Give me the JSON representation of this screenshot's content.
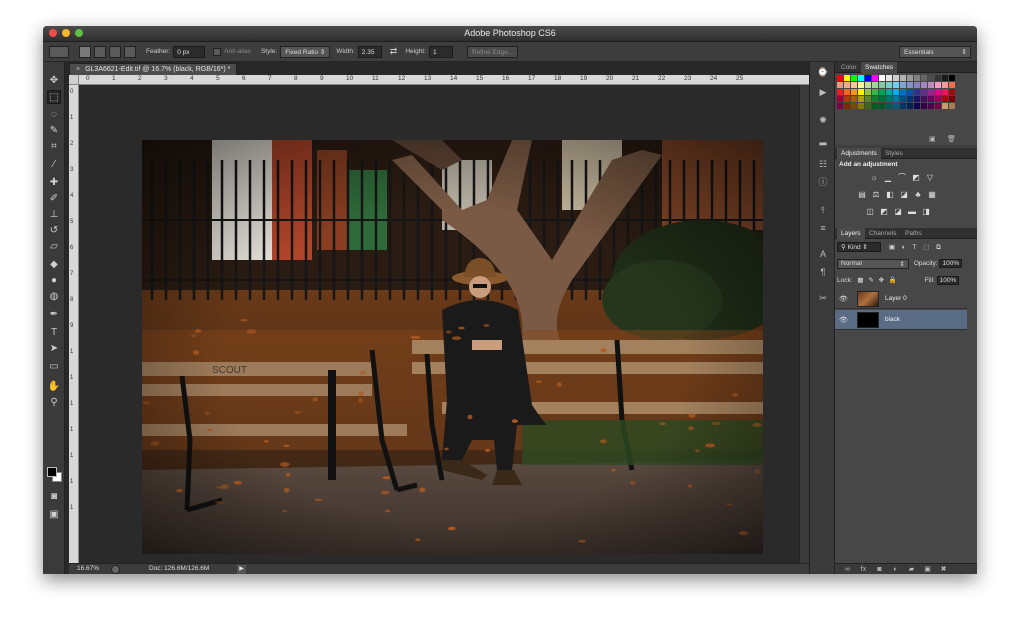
{
  "window": {
    "title": "Adobe Photoshop CS6"
  },
  "options_bar": {
    "feather_label": "Feather:",
    "feather_value": "0 px",
    "anti_alias_label": "Anti-alias",
    "style_label": "Style:",
    "style_value": "Fixed Ratio",
    "width_label": "Width:",
    "width_value": "2.35",
    "height_label": "Height:",
    "height_value": "1",
    "refine_edge_label": "Refine Edge...",
    "workspace_value": "Essentials"
  },
  "document": {
    "tab_title": "GL3A6621-Edit.tif @ 16.7% (black, RGB/16*) *",
    "ruler_h": [
      "0",
      "1",
      "2",
      "3",
      "4",
      "5",
      "6",
      "7",
      "8",
      "9",
      "10",
      "11",
      "12",
      "13",
      "14",
      "15",
      "16",
      "17",
      "18",
      "19",
      "20",
      "21",
      "22",
      "23",
      "24",
      "25"
    ],
    "ruler_v": [
      "0",
      "1",
      "2",
      "3",
      "4",
      "5",
      "6",
      "7",
      "8",
      "9",
      "1",
      "1",
      "1",
      "1",
      "1",
      "1",
      "1"
    ]
  },
  "status_bar": {
    "zoom": "16.67%",
    "doc_size": "Doc: 126.6M/126.6M"
  },
  "panels": {
    "color_tabs": [
      "Color",
      "Swatches"
    ],
    "adjustments_tabs": [
      "Adjustments",
      "Styles"
    ],
    "adjustments_title": "Add an adjustment",
    "layers_tabs": [
      "Layers",
      "Channels",
      "Paths"
    ],
    "kind_label": "Kind",
    "blend_mode": "Normal",
    "opacity_label": "Opacity:",
    "opacity_value": "100%",
    "lock_label": "Lock:",
    "fill_label": "Fill:",
    "fill_value": "100%",
    "layers": [
      {
        "name": "Layer 0"
      },
      {
        "name": "black"
      }
    ]
  },
  "swatch_colors": [
    "#ff0000",
    "#ffff00",
    "#00ff00",
    "#00ffff",
    "#0000ff",
    "#ff00ff",
    "#ffffff",
    "#e6e6e6",
    "#cccccc",
    "#b3b3b3",
    "#999999",
    "#808080",
    "#666666",
    "#4d4d4d",
    "#333333",
    "#1a1a1a",
    "#000000",
    "#f7977a",
    "#f9ad81",
    "#fdc68a",
    "#fff79a",
    "#c4df9b",
    "#a3d39c",
    "#82ca9d",
    "#7bcdc8",
    "#6ecff6",
    "#7ea7d8",
    "#8493ca",
    "#8882be",
    "#a187be",
    "#bc8dbf",
    "#f49ac2",
    "#f6989d",
    "#f26c4f",
    "#ed1c24",
    "#f26522",
    "#f7941d",
    "#fff200",
    "#8dc73f",
    "#39b54a",
    "#00a651",
    "#00a99d",
    "#00aeef",
    "#0072bc",
    "#0054a6",
    "#2e3192",
    "#662d91",
    "#92278f",
    "#ec008c",
    "#ed145b",
    "#9e0b0f",
    "#9e0039",
    "#a0410d",
    "#a36209",
    "#aba000",
    "#598527",
    "#1a7b30",
    "#007236",
    "#00746b",
    "#0076a3",
    "#004b80",
    "#003471",
    "#1b1464",
    "#440e62",
    "#630460",
    "#9e005d",
    "#9e0b0f",
    "#790000",
    "#7b0046",
    "#7b2e00",
    "#7d4900",
    "#827b00",
    "#406618",
    "#005e20",
    "#005826",
    "#005952",
    "#005b7f",
    "#003663",
    "#002157",
    "#0d004c",
    "#32004b",
    "#4b0049",
    "#7b0046",
    "#c69c6d",
    "#a67c52"
  ]
}
